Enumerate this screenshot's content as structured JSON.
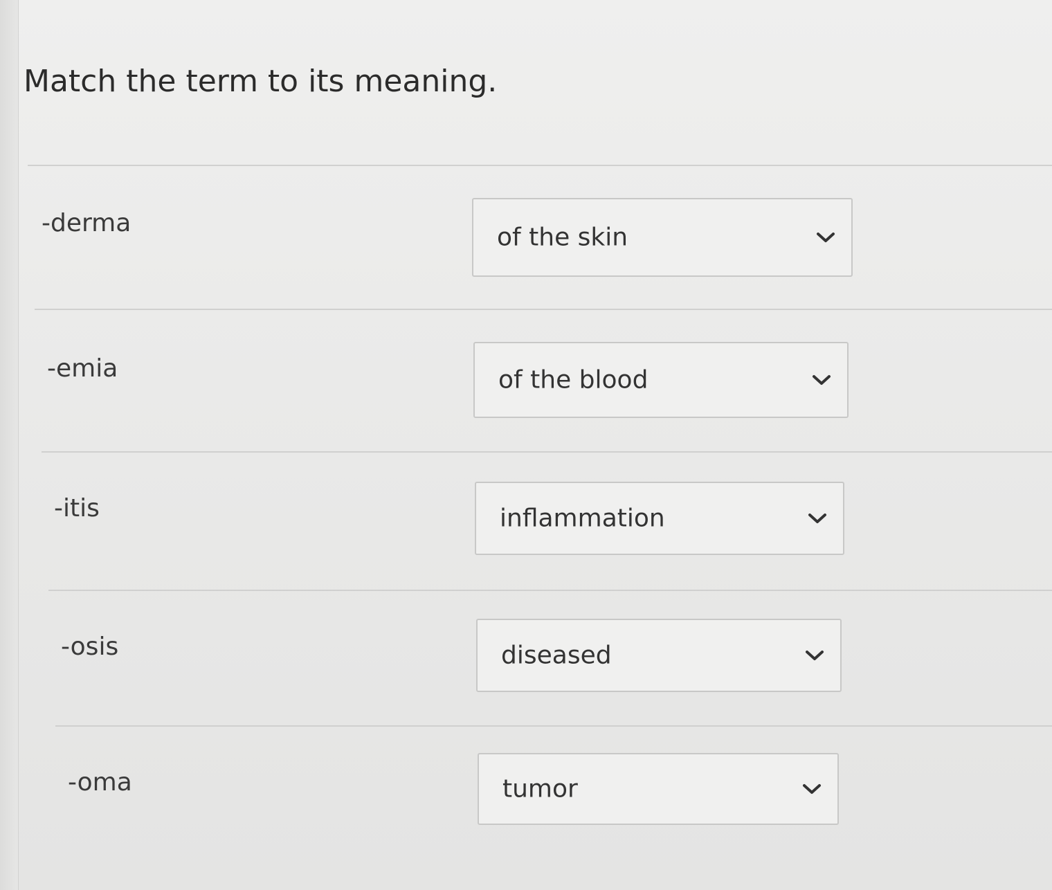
{
  "question": {
    "title": "Match the term to its meaning."
  },
  "rows": [
    {
      "term": "-derma",
      "selected": "of the skin"
    },
    {
      "term": "-emia",
      "selected": "of the blood"
    },
    {
      "term": "-itis",
      "selected": "inflammation"
    },
    {
      "term": "-osis",
      "selected": "diseased"
    },
    {
      "term": "-oma",
      "selected": "tumor"
    }
  ],
  "icons": {
    "dropdown": "chevron-down-icon"
  }
}
